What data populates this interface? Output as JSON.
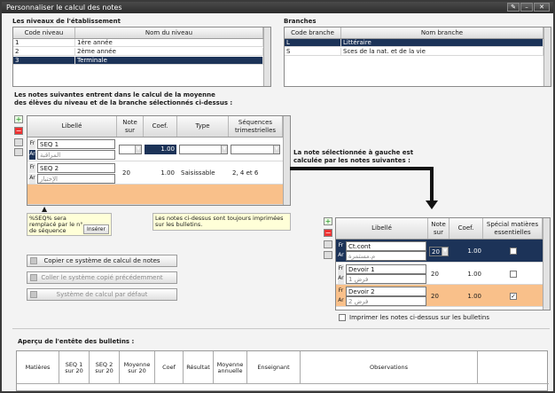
{
  "window": {
    "title": "Personnaliser le calcul des notes"
  },
  "niveaux": {
    "title": "Les niveaux de l'établissement",
    "col_code": "Code niveau",
    "col_nom": "Nom du niveau",
    "rows": [
      {
        "code": "1",
        "nom": "1ère année"
      },
      {
        "code": "2",
        "nom": "2ème année"
      },
      {
        "code": "3",
        "nom": "Terminale"
      }
    ]
  },
  "branches": {
    "title": "Branches",
    "col_code": "Code branche",
    "col_nom": "Nom branche",
    "rows": [
      {
        "code": "L",
        "nom": "Littéraire"
      },
      {
        "code": "S",
        "nom": "Sces de la nat. et de la vie"
      }
    ]
  },
  "notes": {
    "intro1": "Les notes suivantes entrent dans le calcul de la moyenne",
    "intro2": "des élèves du niveau et de la branche sélectionnés ci-dessus :",
    "col_libelle": "Libellé",
    "col_note": "Note",
    "col_note2": "sur",
    "col_coef": "Coef.",
    "col_type": "Type",
    "col_seq": "Séquences",
    "col_seq2": "trimestrielles",
    "rows": [
      {
        "fr": "SEQ 1",
        "ar": "المراقبة",
        "sur": "20",
        "coef": "1.00",
        "type": "Calculée",
        "seq": "1, 3 et 5"
      },
      {
        "fr": "SEQ 2",
        "ar": "الإختبار",
        "sur": "20",
        "coef": "1.00",
        "type": "Saisissable",
        "seq": "2, 4 et 6"
      }
    ],
    "fr": "Fr",
    "ar": "Ar"
  },
  "notes_info": "Les notes ci-dessus sont toujours imprimées sur les bulletins.",
  "seq_note": "%SEQ% sera remplacé par le n° de séquence",
  "inserer": "Insérer",
  "buttons": {
    "copier": "Copier ce système de calcul de notes",
    "coller": "Coller le système copié précédemment",
    "defaut": "Système de calcul par défaut"
  },
  "calc": {
    "label1": "La note sélectionnée à gauche est",
    "label2": "calculée par les notes suivantes :",
    "col_libelle": "Libellé",
    "col_note": "Note",
    "col_note2": "sur",
    "col_coef": "Coef.",
    "col_spec": "Spécial matières",
    "col_spec2": "essentielles",
    "rows": [
      {
        "fr": "Ct.cont",
        "ar": "م.مستمرة",
        "sur": "20",
        "coef": "1.00",
        "checked": false
      },
      {
        "fr": "Devoir 1",
        "ar": "فرض 1",
        "sur": "20",
        "coef": "1.00",
        "checked": false
      },
      {
        "fr": "Devoir 2",
        "ar": "فرض 2",
        "sur": "20",
        "coef": "1.00",
        "checked": true
      }
    ],
    "print": "Imprimer les notes ci-dessus sur les bulletins"
  },
  "apercu": {
    "title": "Aperçu de l'entête des bulletins :",
    "cols": [
      "Matières",
      "SEQ 1\nsur 20",
      "SEQ 2\nsur 20",
      "Moyenne\nsur 20",
      "Coef",
      "Résultat",
      "Moyenne\nannuelle",
      "Enseignant",
      "Observations"
    ]
  }
}
